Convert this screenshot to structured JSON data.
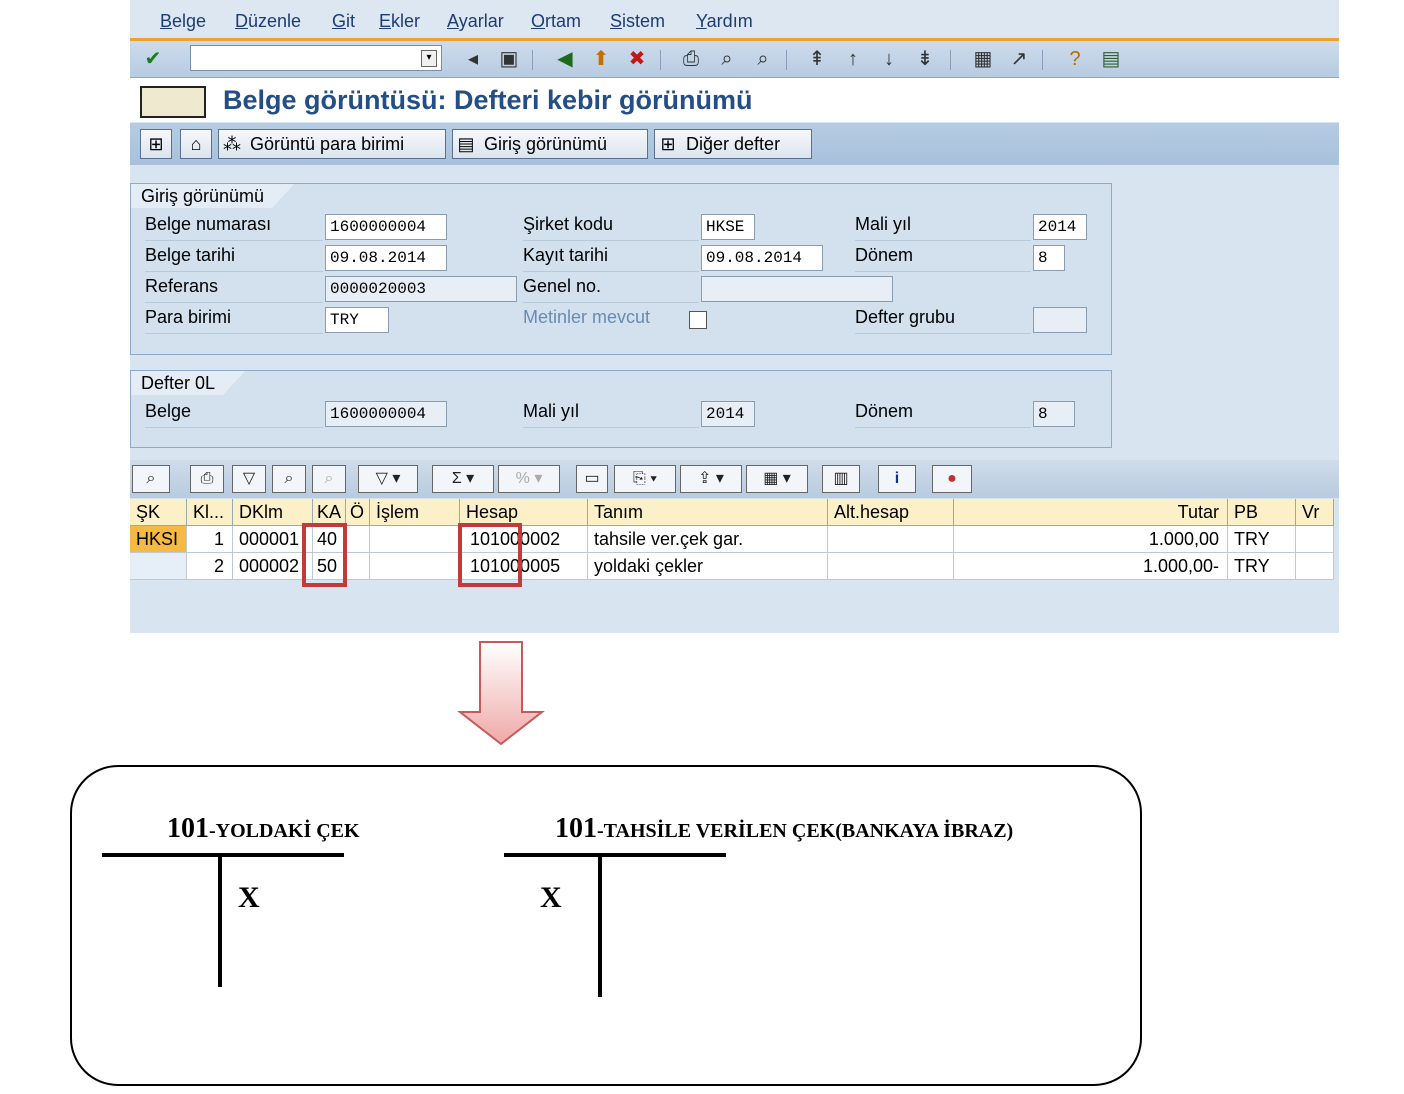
{
  "menu": [
    "Belge",
    "Düzenle",
    "Git",
    "Ekler",
    "Ayarlar",
    "Ortam",
    "Sistem",
    "Yardım"
  ],
  "page_title": "Belge görüntüsü: Defteri kebir görünümü",
  "app_toolbar": {
    "currency_btn": "Görüntü para birimi",
    "entry_view_btn": "Giriş görünümü",
    "other_ledger_btn": "Diğer defter"
  },
  "entry_view": {
    "title": "Giriş görünümü",
    "labels": {
      "doc_no": "Belge numarası",
      "company": "Şirket kodu",
      "fiscal_year": "Mali yıl",
      "doc_date": "Belge tarihi",
      "posting_date": "Kayıt tarihi",
      "period": "Dönem",
      "reference": "Referans",
      "general_no": "Genel no.",
      "currency": "Para birimi",
      "texts": "Metinler mevcut",
      "ledger_group": "Defter grubu"
    },
    "values": {
      "doc_no": "1600000004",
      "company": "HKSE",
      "fiscal_year": "2014",
      "doc_date": "09.08.2014",
      "posting_date": "09.08.2014",
      "period": "8",
      "reference": "0000020003",
      "general_no": "",
      "currency": "TRY",
      "ledger_group": ""
    }
  },
  "ledger": {
    "title": "Defter 0L",
    "labels": {
      "doc": "Belge",
      "fiscal_year": "Mali yıl",
      "period": "Dönem"
    },
    "values": {
      "doc": "1600000004",
      "fiscal_year": "2014",
      "period": "8"
    }
  },
  "grid": {
    "headers": [
      "ŞK",
      "Kl...",
      "DKlm",
      "KA",
      "Ö",
      "İşlem",
      "Hesap",
      "Tanım",
      "Alt.hesap",
      "Tutar",
      "PB",
      "Vr"
    ],
    "rows": [
      [
        "HKSI",
        "1",
        "000001",
        "40",
        "",
        "",
        "101000002",
        "tahsile ver.çek gar.",
        "",
        "1.000,00",
        "TRY",
        ""
      ],
      [
        "",
        "2",
        "000002",
        "50",
        "",
        "",
        "101000005",
        "yoldaki çekler",
        "",
        "1.000,00-",
        "TRY",
        ""
      ]
    ]
  },
  "t_accounts": [
    {
      "number": "101",
      "name": "-YOLDAKİ ÇEK",
      "mark": "X"
    },
    {
      "number": "101",
      "name": "-TAHSİLE VERİLEN ÇEK(BANKAYA İBRAZ)",
      "mark": "X"
    }
  ],
  "colors": {
    "highlight": "#c23b3b",
    "title": "#244e86",
    "arrow": "#f2b8b8"
  }
}
